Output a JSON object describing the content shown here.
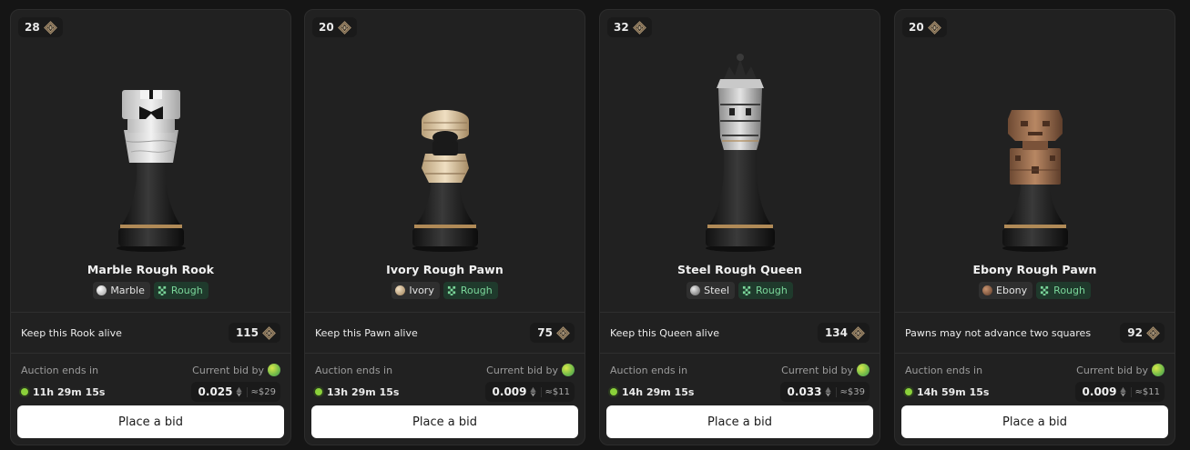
{
  "currency_icon": "coin-icon",
  "labels": {
    "auction_ends": "Auction ends in",
    "current_bid": "Current bid by",
    "place_bid": "Place a bid",
    "usd_prefix": "≈"
  },
  "colors": {
    "card_bg": "#212121",
    "rough_tag": "#7ad69a",
    "live_dot": "#8bd13a",
    "button_bg": "#ffffff"
  },
  "cards": [
    {
      "level": "28",
      "name": "Marble Rough Rook",
      "piece": "rook",
      "material": "Marble",
      "finish": "Rough",
      "objective": "Keep this Rook alive",
      "reward": "115",
      "time_left": "11h 29m 15s",
      "bid": "0.025",
      "usd": "$29"
    },
    {
      "level": "20",
      "name": "Ivory Rough Pawn",
      "piece": "pawn",
      "material": "Ivory",
      "finish": "Rough",
      "objective": "Keep this Pawn alive",
      "reward": "75",
      "time_left": "13h 29m 15s",
      "bid": "0.009",
      "usd": "$11"
    },
    {
      "level": "32",
      "name": "Steel Rough Queen",
      "piece": "queen",
      "material": "Steel",
      "finish": "Rough",
      "objective": "Keep this Queen alive",
      "reward": "134",
      "time_left": "14h 29m 15s",
      "bid": "0.033",
      "usd": "$39"
    },
    {
      "level": "20",
      "name": "Ebony Rough Pawn",
      "piece": "pawn",
      "material": "Ebony",
      "finish": "Rough",
      "objective": "Pawns may not advance two squares",
      "reward": "92",
      "time_left": "14h 59m 15s",
      "bid": "0.009",
      "usd": "$11"
    }
  ]
}
